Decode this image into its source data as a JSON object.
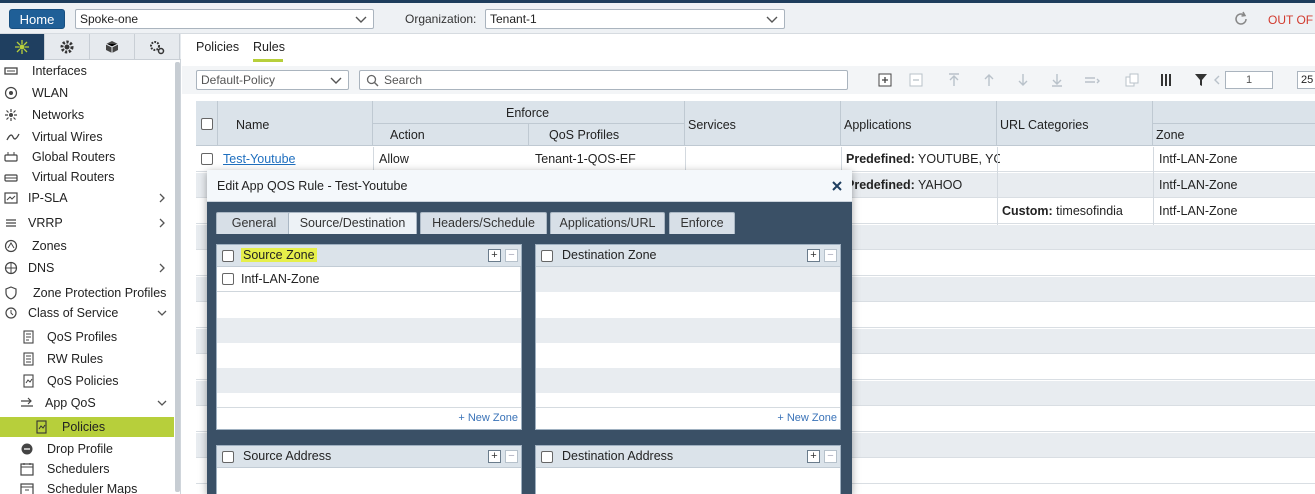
{
  "topbar": {
    "home_label": "Home",
    "device_value": "Spoke-one",
    "org_label": "Organization:",
    "org_value": "Tenant-1",
    "status_text": "OUT OF"
  },
  "sidebar": {
    "items": [
      {
        "label": "Interfaces",
        "icon": "interfaces-icon"
      },
      {
        "label": "WLAN",
        "icon": "wlan-icon"
      },
      {
        "label": "Networks",
        "icon": "networks-icon"
      },
      {
        "label": "Virtual Wires",
        "icon": "virtual-wires-icon"
      },
      {
        "label": "Global Routers",
        "icon": "router-icon"
      },
      {
        "label": "Virtual Routers",
        "icon": "router-icon"
      },
      {
        "label": "IP-SLA",
        "icon": "ip-sla-icon"
      },
      {
        "label": "VRRP",
        "icon": "vrrp-icon"
      },
      {
        "label": "Zones",
        "icon": "zones-icon"
      },
      {
        "label": "DNS",
        "icon": "dns-icon"
      },
      {
        "label": "Zone Protection Profiles",
        "icon": "zone-protection-icon"
      },
      {
        "label": "Class of Service",
        "icon": "class-of-service-icon"
      },
      {
        "label": "QoS Profiles",
        "icon": "qos-profiles-icon"
      },
      {
        "label": "RW Rules",
        "icon": "rw-rules-icon"
      },
      {
        "label": "QoS Policies",
        "icon": "qos-policies-icon"
      },
      {
        "label": "App QoS",
        "icon": "app-qos-icon"
      },
      {
        "label": "Policies",
        "icon": "policies-icon"
      },
      {
        "label": "Drop Profile",
        "icon": "drop-profile-icon"
      },
      {
        "label": "Schedulers",
        "icon": "schedulers-icon"
      },
      {
        "label": "Scheduler Maps",
        "icon": "scheduler-maps-icon"
      }
    ]
  },
  "main": {
    "tabs": [
      "Policies",
      "Rules"
    ],
    "policy_select": "Default-Policy",
    "search_placeholder": "Search",
    "page_number": "1",
    "page_size": "25"
  },
  "table": {
    "headers": {
      "name": "Name",
      "enforce": "Enforce",
      "action": "Action",
      "qos_profiles": "QoS Profiles",
      "services": "Services",
      "applications": "Applications",
      "url_categories": "URL Categories",
      "zone": "Zone"
    },
    "rows": [
      {
        "name": "Test-Youtube",
        "action": "Allow",
        "qos": "Tenant-1-QOS-EF",
        "app_prefix": "Predefined:",
        "app_value": " YOUTUBE, YOU",
        "url_prefix": "",
        "url_value": "",
        "zone": "Intf-LAN-Zone"
      },
      {
        "name": "",
        "action": "",
        "qos": "",
        "app_prefix": "Predefined:",
        "app_value": " YAHOO",
        "url_prefix": "",
        "url_value": "",
        "zone": "Intf-LAN-Zone"
      },
      {
        "name": "",
        "action": "",
        "qos": "",
        "app_prefix": "",
        "app_value": "",
        "url_prefix": "Custom:",
        "url_value": " timesofindia",
        "zone": "Intf-LAN-Zone"
      }
    ]
  },
  "modal": {
    "title": "Edit App QOS Rule - Test-Youtube",
    "tabs": [
      "General",
      "Source/Destination",
      "Headers/Schedule",
      "Applications/URL",
      "Enforce"
    ],
    "source_zone": {
      "title": "Source Zone",
      "items": [
        "Intf-LAN-Zone"
      ],
      "new_label": "+ New Zone"
    },
    "destination_zone": {
      "title": "Destination Zone",
      "new_label": "+ New Zone"
    },
    "source_address": {
      "title": "Source Address"
    },
    "destination_address": {
      "title": "Destination Address"
    }
  },
  "colors": {
    "accent": "#b7cf3b",
    "brand": "#1f5f97",
    "modal_frame": "#3a5066",
    "highlight": "#e6ef4a",
    "alert": "#d23a2e"
  }
}
